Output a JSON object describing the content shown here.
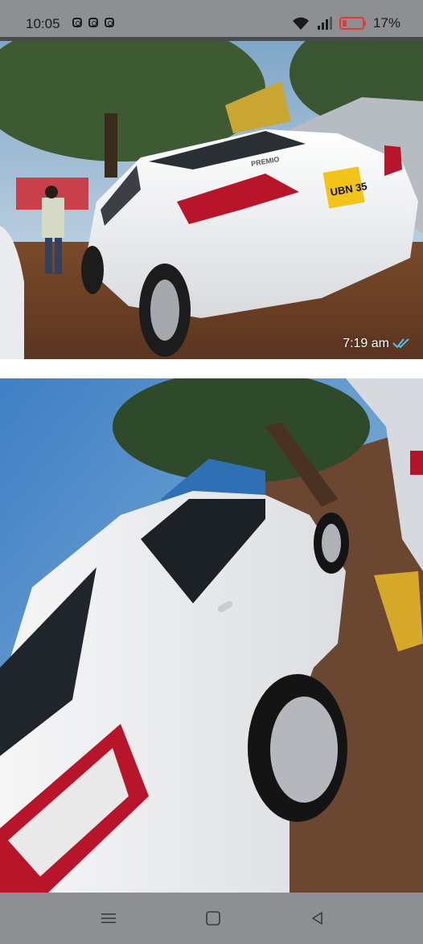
{
  "status_bar": {
    "time": "10:05",
    "notification_icons": [
      "instagram-icon",
      "instagram-icon",
      "instagram-icon"
    ],
    "battery_percent": "17%",
    "battery_color": "#e53935"
  },
  "chat": {
    "messages": [
      {
        "type": "image",
        "subject": "white Toyota Premio rear view",
        "plate_text": "UBN 35",
        "badge_text": "PREMIO",
        "time": "7:19 am",
        "read_status": "double-check-icon",
        "tick_color": "#53bdeb"
      },
      {
        "type": "image",
        "subject": "white Toyota Premio side-rear view"
      }
    ]
  },
  "nav_bar": {
    "buttons": [
      "menu-icon",
      "home-icon",
      "back-icon"
    ]
  }
}
